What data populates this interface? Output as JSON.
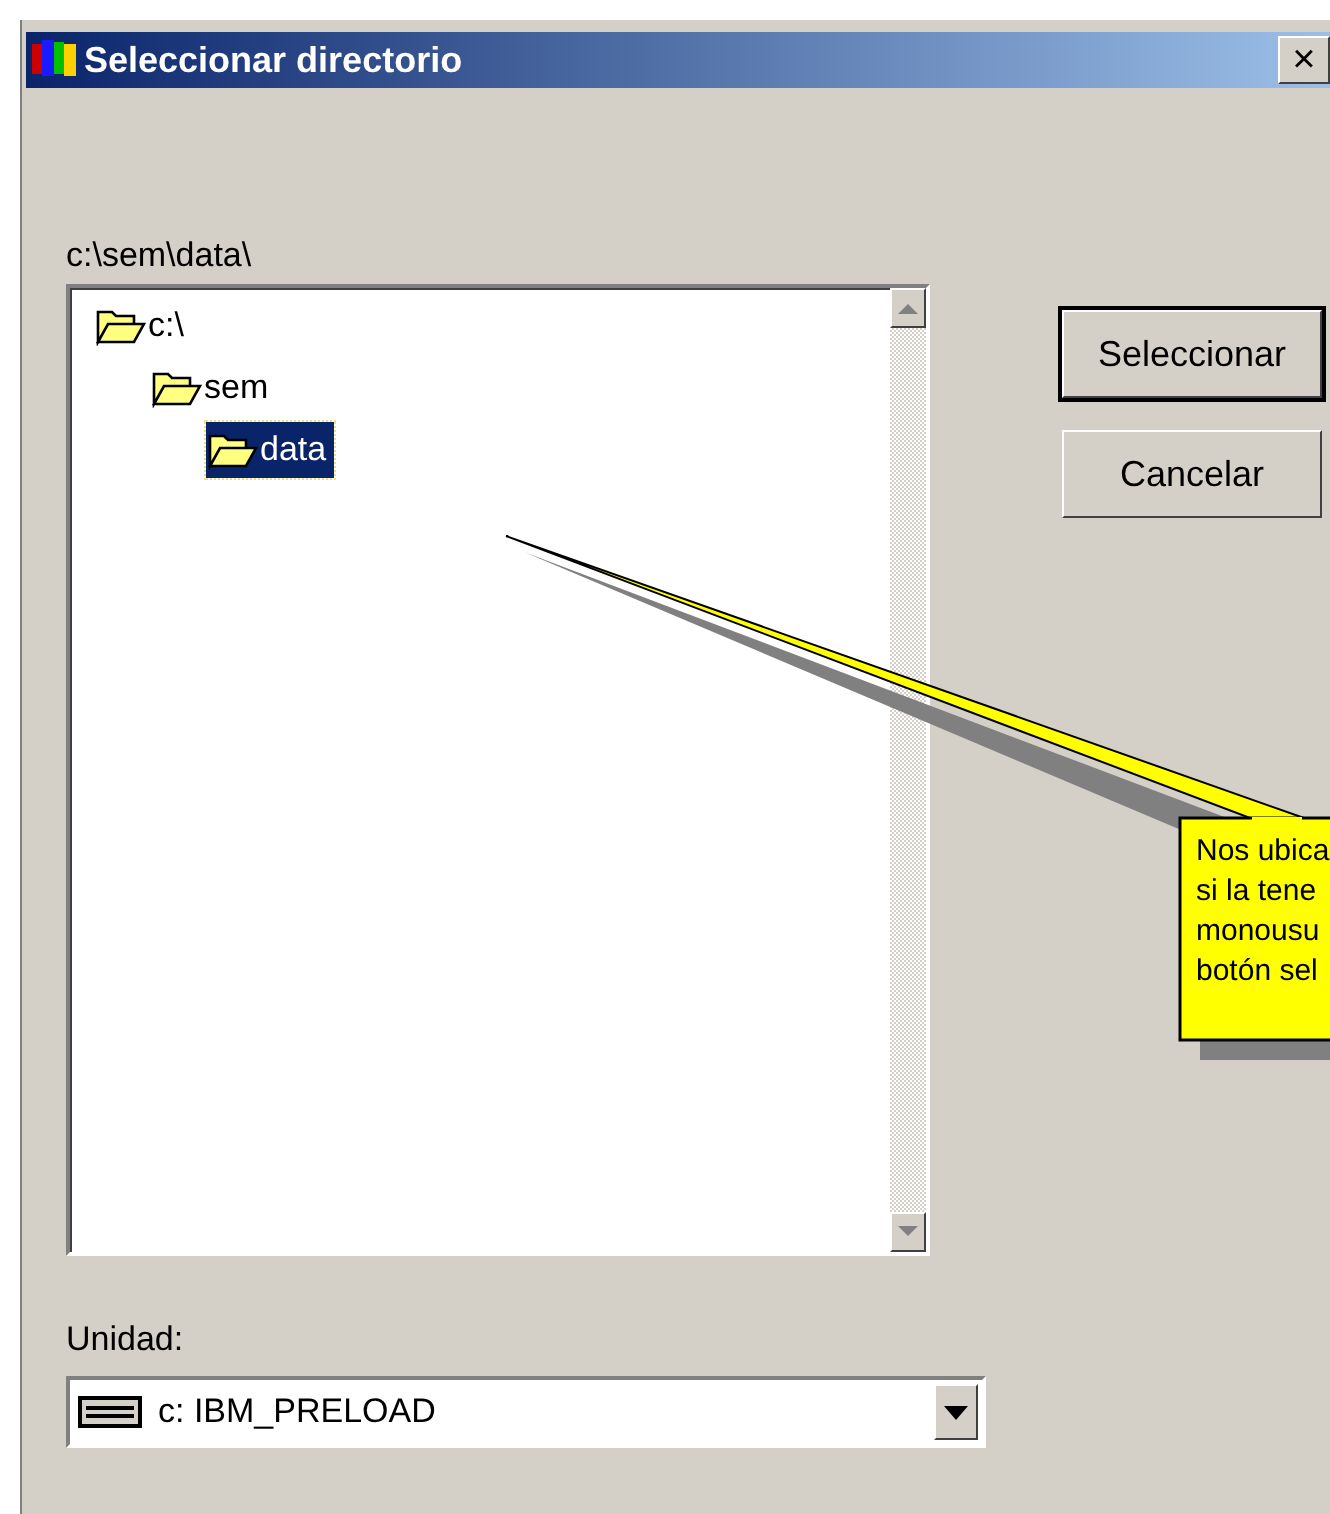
{
  "window": {
    "title": "Seleccionar directorio",
    "close": "×"
  },
  "path_label": "c:\\sem\\data\\",
  "tree": [
    {
      "label": "c:\\",
      "selected": false,
      "children": [
        {
          "label": "sem",
          "selected": false,
          "children": [
            {
              "label": "data",
              "selected": true
            }
          ]
        }
      ]
    }
  ],
  "buttons": [
    {
      "label": "Seleccionar",
      "default": true
    },
    {
      "label": "Cancelar",
      "default": false
    }
  ],
  "drive": {
    "label": "Unidad:",
    "value": "c: IBM_PRELOAD"
  },
  "callout": {
    "lines": [
      "Nos ubica",
      "si la tene",
      "monousu",
      "botón sel"
    ]
  }
}
